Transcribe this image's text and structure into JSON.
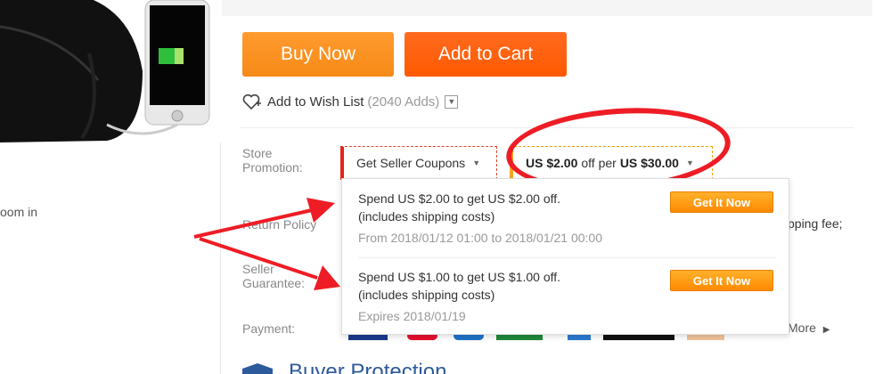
{
  "product": {
    "zoom_hint": "oom in"
  },
  "actions": {
    "buy_now": "Buy Now",
    "add_to_cart": "Add to Cart"
  },
  "wishlist": {
    "label": "Add to Wish List",
    "count": "(2040 Adds)"
  },
  "store_promotion": {
    "label_line1": "Store",
    "label_line2": "Promotion:",
    "coupons_button": "Get Seller Coupons",
    "promo_amount": "US $2.00",
    "promo_mid": "off per",
    "promo_threshold": "US $30.00"
  },
  "coupons_popup": {
    "items": [
      {
        "title": "Spend US $2.00 to get US $2.00 off.",
        "note": "(includes shipping costs)",
        "validity": "From 2018/01/12 01:00 to 2018/01/21 00:00",
        "button": "Get It Now"
      },
      {
        "title": "Spend US $1.00 to get US $1.00 off.",
        "note": "(includes shipping costs)",
        "validity": "Expires 2018/01/19",
        "button": "Get It Now"
      }
    ]
  },
  "rows": {
    "return_policy": "Return Policy",
    "seller_guarantee_line1": "Seller",
    "seller_guarantee_line2": "Guarantee:",
    "payment": "Payment:",
    "shipping_fragment": "pping fee;",
    "more_link": "More"
  },
  "buyer_protection": {
    "title": "Buyer Protection"
  },
  "colors": {
    "buy_now": "#f68a17",
    "add_to_cart": "#ff5a00",
    "annotation_red": "#ee1d25",
    "coupon_button": "#ff8a00"
  }
}
